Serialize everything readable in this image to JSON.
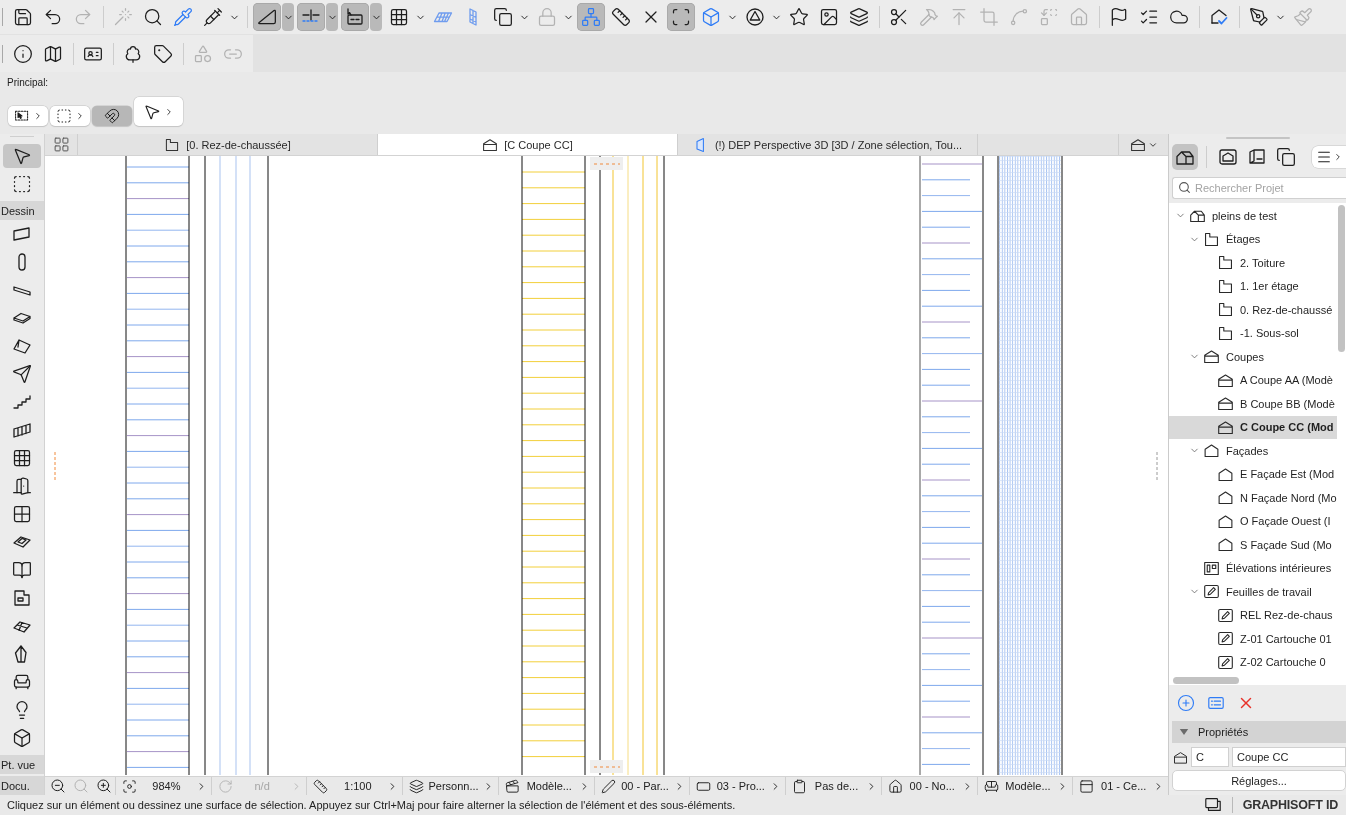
{
  "toolbars": [
    {
      "items": [
        {
          "kind": "button",
          "pressed": false,
          "disabled": false,
          "menu": false
        },
        {
          "kind": "button",
          "pressed": false,
          "disabled": false,
          "menu": false
        },
        {
          "kind": "button",
          "pressed": false,
          "disabled": true,
          "menu": false
        },
        {
          "kind": "separator"
        },
        {
          "kind": "button",
          "pressed": false,
          "disabled": true,
          "menu": false
        },
        {
          "kind": "button",
          "pressed": false,
          "disabled": false,
          "menu": false
        },
        {
          "kind": "button",
          "pressed": false,
          "disabled": false,
          "menu": false
        },
        {
          "kind": "button",
          "pressed": false,
          "disabled": false,
          "menu": true
        },
        {
          "kind": "separator"
        },
        {
          "kind": "button",
          "pressed": true,
          "disabled": false,
          "menu": true
        },
        {
          "kind": "button",
          "pressed": true,
          "disabled": false,
          "menu": true
        },
        {
          "kind": "button",
          "pressed": true,
          "disabled": false,
          "menu": true
        },
        {
          "kind": "button",
          "pressed": false,
          "disabled": false,
          "menu": true
        },
        {
          "kind": "button",
          "pressed": false,
          "disabled": false,
          "menu": false
        },
        {
          "kind": "button",
          "pressed": false,
          "disabled": false,
          "menu": false
        },
        {
          "kind": "button",
          "pressed": false,
          "disabled": false,
          "menu": true
        },
        {
          "kind": "button",
          "pressed": false,
          "disabled": true,
          "menu": true
        },
        {
          "kind": "button",
          "pressed": true,
          "disabled": false,
          "menu": false
        },
        {
          "kind": "button",
          "pressed": false,
          "disabled": false,
          "menu": false
        },
        {
          "kind": "button",
          "pressed": false,
          "disabled": false,
          "menu": false
        },
        {
          "kind": "button",
          "pressed": true,
          "disabled": false,
          "menu": false
        },
        {
          "kind": "button",
          "pressed": false,
          "disabled": false,
          "menu": true
        },
        {
          "kind": "button",
          "pressed": false,
          "disabled": false,
          "menu": true
        },
        {
          "kind": "button",
          "pressed": false,
          "disabled": false,
          "menu": false
        },
        {
          "kind": "button",
          "pressed": false,
          "disabled": false,
          "menu": false
        },
        {
          "kind": "button",
          "pressed": false,
          "disabled": false,
          "menu": false
        },
        {
          "kind": "separator"
        },
        {
          "kind": "button",
          "pressed": false,
          "disabled": false,
          "menu": false
        },
        {
          "kind": "button",
          "pressed": false,
          "disabled": true,
          "menu": false
        },
        {
          "kind": "button",
          "pressed": false,
          "disabled": true,
          "menu": false
        },
        {
          "kind": "button",
          "pressed": false,
          "disabled": true,
          "menu": false
        },
        {
          "kind": "button",
          "pressed": false,
          "disabled": true,
          "menu": false
        },
        {
          "kind": "button",
          "pressed": false,
          "disabled": true,
          "menu": false
        },
        {
          "kind": "button",
          "pressed": false,
          "disabled": true,
          "menu": false
        },
        {
          "kind": "separator"
        },
        {
          "kind": "button",
          "pressed": false,
          "disabled": false,
          "menu": false
        },
        {
          "kind": "button",
          "pressed": false,
          "disabled": false,
          "menu": false
        },
        {
          "kind": "button",
          "pressed": false,
          "disabled": false,
          "menu": false
        },
        {
          "kind": "separator"
        },
        {
          "kind": "button",
          "pressed": false,
          "disabled": false,
          "menu": false
        },
        {
          "kind": "separator"
        },
        {
          "kind": "button",
          "pressed": false,
          "disabled": false,
          "menu": true
        },
        {
          "kind": "button",
          "pressed": false,
          "disabled": true,
          "menu": false
        }
      ]
    },
    {
      "items": [
        {
          "kind": "button",
          "pressed": false,
          "disabled": false,
          "menu": false
        },
        {
          "kind": "button",
          "pressed": false,
          "disabled": false,
          "menu": false
        },
        {
          "kind": "separator"
        },
        {
          "kind": "button",
          "pressed": false,
          "disabled": false,
          "menu": false
        },
        {
          "kind": "separator"
        },
        {
          "kind": "button",
          "pressed": false,
          "disabled": false,
          "menu": false
        },
        {
          "kind": "button",
          "pressed": false,
          "disabled": false,
          "menu": false
        },
        {
          "kind": "separator"
        },
        {
          "kind": "button",
          "pressed": false,
          "disabled": true,
          "menu": false
        },
        {
          "kind": "button",
          "pressed": false,
          "disabled": true,
          "menu": false
        }
      ]
    }
  ],
  "principal": {
    "label": "Principal:",
    "buttons": [
      {
        "kind": "small",
        "pressed": false,
        "menu": true
      },
      {
        "kind": "small",
        "pressed": false,
        "menu": true
      },
      {
        "kind": "small",
        "pressed": true,
        "menu": false
      },
      {
        "kind": "large",
        "pressed": false,
        "menu": true
      }
    ]
  },
  "toolbox": {
    "items": [
      {
        "kind": "tool",
        "selected": true
      },
      {
        "kind": "tool",
        "selected": false
      },
      {
        "kind": "header",
        "label": "Dessin"
      },
      {
        "kind": "tool",
        "selected": false
      },
      {
        "kind": "tool",
        "selected": false
      },
      {
        "kind": "tool",
        "selected": false
      },
      {
        "kind": "tool",
        "selected": false
      },
      {
        "kind": "tool",
        "selected": false
      },
      {
        "kind": "tool",
        "selected": false
      },
      {
        "kind": "tool",
        "selected": false
      },
      {
        "kind": "tool",
        "selected": false
      },
      {
        "kind": "tool",
        "selected": false
      },
      {
        "kind": "tool",
        "selected": false
      },
      {
        "kind": "tool",
        "selected": false
      },
      {
        "kind": "tool",
        "selected": false
      },
      {
        "kind": "tool",
        "selected": false
      },
      {
        "kind": "tool",
        "selected": false
      },
      {
        "kind": "tool",
        "selected": false
      },
      {
        "kind": "tool",
        "selected": false
      },
      {
        "kind": "tool",
        "selected": false
      },
      {
        "kind": "tool",
        "selected": false
      },
      {
        "kind": "tool",
        "selected": false
      },
      {
        "kind": "header",
        "label": "Pt. vue"
      },
      {
        "kind": "header",
        "label": "Docu."
      }
    ]
  },
  "tabs": [
    {
      "label": "[0. Rez-de-chaussée]",
      "kind": "plan",
      "selected": false
    },
    {
      "label": "[C Coupe CC]",
      "kind": "section",
      "selected": true
    },
    {
      "label": "(!) DEP Perspective 3D [3D / Zone sélection, Tou...",
      "kind": "perspective",
      "selected": false
    }
  ],
  "navigator": {
    "modes": [
      {
        "selected": true
      },
      {
        "selected": false
      },
      {
        "selected": false
      },
      {
        "selected": false
      }
    ],
    "search": {
      "placeholder": "Rechercher Projet"
    },
    "tree": [
      {
        "label": "pleins de test",
        "kind": "project",
        "expanded": true,
        "selected": false,
        "children": [
          {
            "label": "Étages",
            "kind": "stories",
            "expanded": true,
            "selected": false,
            "children": [
              {
                "label": "2. Toiture",
                "kind": "story",
                "selected": false
              },
              {
                "label": "1. 1er étage",
                "kind": "story",
                "selected": false
              },
              {
                "label": "0. Rez-de-chaussé",
                "kind": "story",
                "selected": false
              },
              {
                "label": "-1. Sous-sol",
                "kind": "story",
                "selected": false
              }
            ]
          },
          {
            "label": "Coupes",
            "kind": "sections",
            "expanded": true,
            "selected": false,
            "children": [
              {
                "label": "A Coupe AA (Modè",
                "kind": "section",
                "selected": false
              },
              {
                "label": "B Coupe BB (Modè",
                "kind": "section",
                "selected": false
              },
              {
                "label": "C Coupe CC (Mod",
                "kind": "section",
                "selected": true
              }
            ]
          },
          {
            "label": "Façades",
            "kind": "elevations",
            "expanded": true,
            "selected": false,
            "children": [
              {
                "label": "E Façade Est (Mod",
                "kind": "elevation",
                "selected": false
              },
              {
                "label": "N Façade Nord (Mo",
                "kind": "elevation",
                "selected": false
              },
              {
                "label": "O Façade Ouest (I",
                "kind": "elevation",
                "selected": false
              },
              {
                "label": "S Façade Sud (Mo",
                "kind": "elevation",
                "selected": false
              }
            ]
          },
          {
            "label": "Élévations intérieures",
            "kind": "interior",
            "selected": false
          },
          {
            "label": "Feuilles de travail",
            "kind": "worksheets",
            "expanded": true,
            "selected": false,
            "children": [
              {
                "label": "REL Rez-de-chaus",
                "kind": "worksheet",
                "selected": false
              },
              {
                "label": "Z-01 Cartouche 01",
                "kind": "worksheet",
                "selected": false
              },
              {
                "label": "Z-02 Cartouche 0",
                "kind": "worksheet",
                "selected": false
              }
            ]
          }
        ]
      }
    ],
    "properties": {
      "title": "Propriétés",
      "expanded": true,
      "reference": "C",
      "name": "Coupe CC",
      "button": "Réglages..."
    }
  },
  "status_bar": {
    "nav": [
      {
        "disabled": false
      },
      {
        "disabled": true
      },
      {
        "disabled": false
      }
    ],
    "items": [
      {
        "text": "984%",
        "disabled": false
      },
      {
        "text": "n/d",
        "disabled": true
      },
      {
        "text": "1:100",
        "disabled": false
      },
      {
        "text": "Personn...",
        "disabled": false
      },
      {
        "text": "Modèle...",
        "disabled": false
      },
      {
        "text": "00 - Par...",
        "disabled": false
      },
      {
        "text": "03 - Pro...",
        "disabled": false
      },
      {
        "text": "Pas de...",
        "disabled": false
      },
      {
        "text": "00 - No...",
        "disabled": false
      },
      {
        "text": "Modèle...",
        "disabled": false
      },
      {
        "text": "01 - Ce...",
        "disabled": false
      }
    ]
  },
  "message": "Cliquez sur un élément ou dessinez une surface de sélection. Appuyez sur Ctrl+Maj pour faire alterner la sélection de l'élément et des sous-éléments.",
  "brand": "GRAPHISOFT ID"
}
